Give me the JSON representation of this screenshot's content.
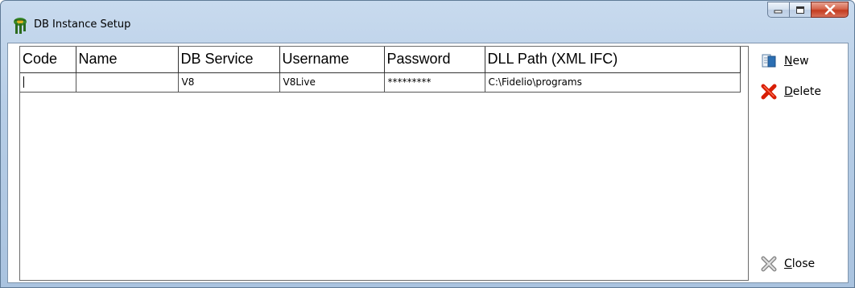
{
  "window": {
    "title": "DB Instance Setup",
    "icon": "fidelio-app-icon",
    "buttons": {
      "minimize": "minimize-icon",
      "maximize": "maximize-icon",
      "close": "close-icon"
    }
  },
  "grid": {
    "columns": [
      "Code",
      "Name",
      "DB Service",
      "Username",
      "Password",
      "DLL Path (XML IFC)"
    ],
    "rows": [
      {
        "code": "",
        "name": "",
        "db_service": "V8",
        "username": "V8Live",
        "password": "*********",
        "dll_path": "C:\\Fidelio\\programs"
      }
    ]
  },
  "actions": {
    "new": {
      "label_first": "N",
      "label_rest": "ew",
      "icon": "new-document-icon"
    },
    "delete": {
      "label_first": "D",
      "label_rest": "elete",
      "icon": "delete-x-icon"
    },
    "close": {
      "label_first": "C",
      "label_rest": "lose",
      "icon": "close-x-icon"
    }
  },
  "colors": {
    "titlebar": "#b6cde6",
    "close_button": "#c43b1f",
    "delete_icon": "#d81e05"
  }
}
